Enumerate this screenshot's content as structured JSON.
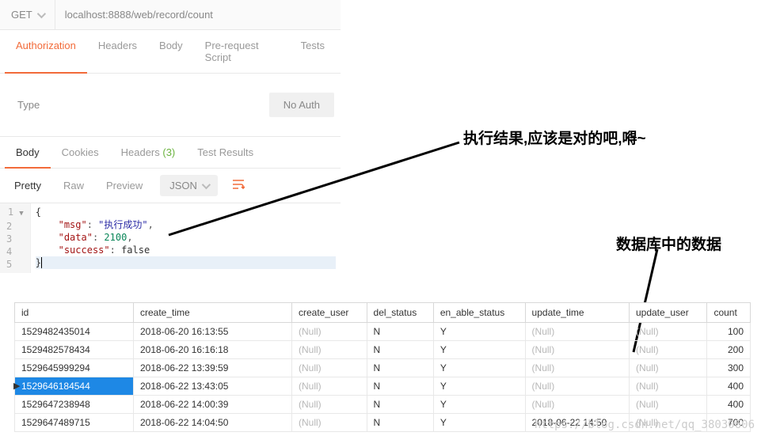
{
  "request": {
    "method": "GET",
    "url": "localhost:8888/web/record/count"
  },
  "req_tabs": {
    "authorization": "Authorization",
    "headers": "Headers",
    "body": "Body",
    "prerequest": "Pre-request Script",
    "tests": "Tests"
  },
  "auth": {
    "type_label": "Type",
    "value": "No Auth"
  },
  "res_tabs": {
    "body": "Body",
    "cookies": "Cookies",
    "headers": "Headers",
    "headers_count": "(3)",
    "test_results": "Test Results"
  },
  "view": {
    "pretty": "Pretty",
    "raw": "Raw",
    "preview": "Preview",
    "format": "JSON"
  },
  "code": {
    "line1": "{",
    "msg_key": "\"msg\"",
    "msg_val": "\"执行成功\"",
    "data_key": "\"data\"",
    "data_val": "2100",
    "success_key": "\"success\"",
    "success_val": "false",
    "line5": "}"
  },
  "annotations": {
    "result_note": "执行结果,应该是对的吧,嘚~",
    "db_note": "数据库中的数据"
  },
  "db": {
    "headers": {
      "id": "id",
      "create_time": "create_time",
      "create_user": "create_user",
      "del_status": "del_status",
      "en_able_status": "en_able_status",
      "update_time": "update_time",
      "update_user": "update_user",
      "count": "count"
    },
    "null_text": "(Null)",
    "rows": [
      {
        "id": "1529482435014",
        "create_time": "2018-06-20 16:13:55",
        "del_status": "N",
        "en_able_status": "Y",
        "update_time": "(Null)",
        "count": "100"
      },
      {
        "id": "1529482578434",
        "create_time": "2018-06-20 16:16:18",
        "del_status": "N",
        "en_able_status": "Y",
        "update_time": "(Null)",
        "count": "200"
      },
      {
        "id": "1529645999294",
        "create_time": "2018-06-22 13:39:59",
        "del_status": "N",
        "en_able_status": "Y",
        "update_time": "(Null)",
        "count": "300"
      },
      {
        "id": "1529646184544",
        "create_time": "2018-06-22 13:43:05",
        "del_status": "N",
        "en_able_status": "Y",
        "update_time": "(Null)",
        "count": "400",
        "selected": true
      },
      {
        "id": "1529647238948",
        "create_time": "2018-06-22 14:00:39",
        "del_status": "N",
        "en_able_status": "Y",
        "update_time": "(Null)",
        "count": "400"
      },
      {
        "id": "1529647489715",
        "create_time": "2018-06-22 14:04:50",
        "del_status": "N",
        "en_able_status": "Y",
        "update_time": "2018-06-22 14:50",
        "count": "700"
      }
    ]
  },
  "watermark": "https://blog.csdn.net/qq_38030606"
}
